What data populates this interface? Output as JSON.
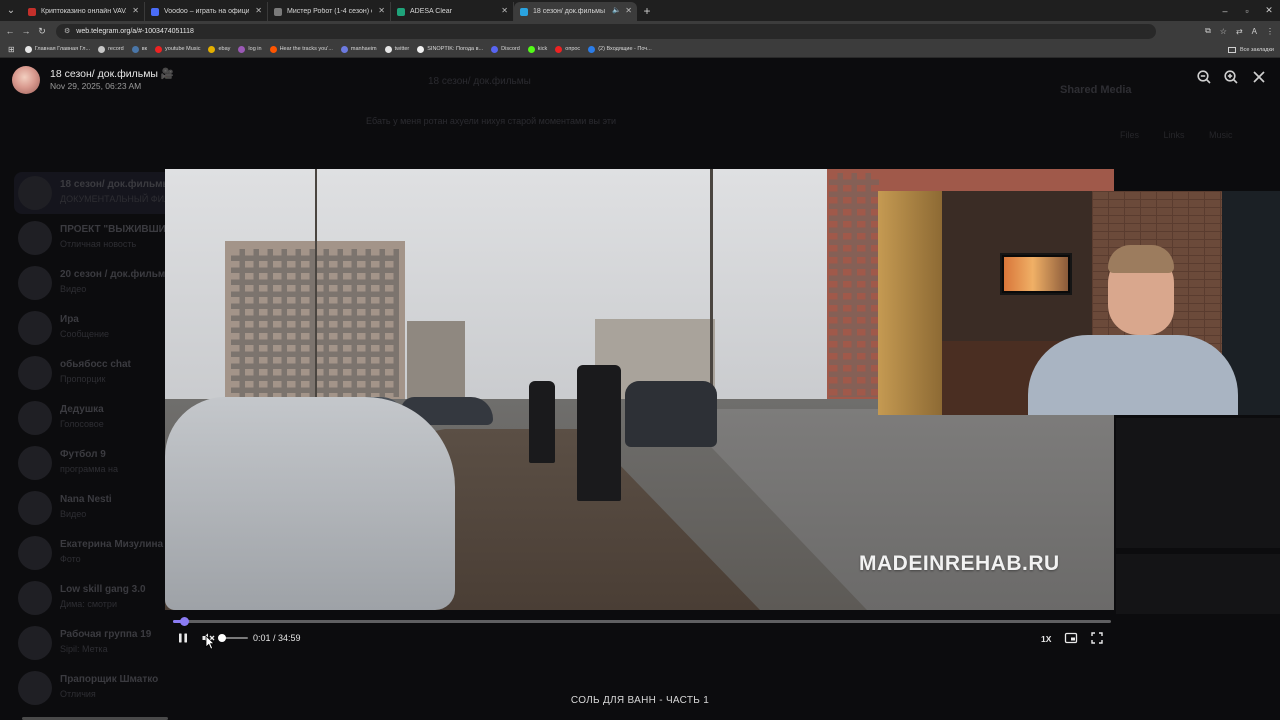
{
  "browser": {
    "tabs": [
      {
        "label": "Криптоказино онлайн VAVADA",
        "favicon_color": "#c4302b",
        "active": false
      },
      {
        "label": "Voodoo – играть на официальн",
        "favicon_color": "#4a6cf7",
        "active": false
      },
      {
        "label": "Мистер Робот (1-4 сезон) см",
        "favicon_color": "#7a7a7a",
        "active": false
      },
      {
        "label": "ADESA Clear",
        "favicon_color": "#1fa37a",
        "active": false
      },
      {
        "label": "18 сезон/ док.фильмы",
        "favicon_color": "#2aa3e0",
        "active": true
      }
    ],
    "address": "web.telegram.org/a/#-1003474051118",
    "bookmarks": [
      {
        "label": "Главная Главная Гл...",
        "color": "#e6e6e6"
      },
      {
        "label": "record",
        "color": "#c7c7c7"
      },
      {
        "label": "вк",
        "color": "#4a76a8"
      },
      {
        "label": "youtube Music",
        "color": "#e22"
      },
      {
        "label": "ebay",
        "color": "#e5b000"
      },
      {
        "label": "log in",
        "color": "#9b59b6"
      },
      {
        "label": "Hear the tracks you'...",
        "color": "#ff5500"
      },
      {
        "label": "manhaeim",
        "color": "#6c7ae0"
      },
      {
        "label": "twitter",
        "color": "#e6e6e6"
      },
      {
        "label": "SINOPTIK: Погода в...",
        "color": "#f0f0f0"
      },
      {
        "label": "Discord",
        "color": "#5865f2"
      },
      {
        "label": "kick",
        "color": "#53fc18"
      },
      {
        "label": "опрос",
        "color": "#e22"
      },
      {
        "label": "(2) Входящие - Поч...",
        "color": "#2b7de9"
      }
    ],
    "bookmarks_all": "Все закладки"
  },
  "viewer": {
    "title": "18 сезон/ док.фильмы 🎥",
    "date": "Nov 29, 2025, 06:23 AM",
    "zoom_out_icon": "zoom-out-icon",
    "zoom_in_icon": "zoom-in-icon",
    "close_icon": "close-icon"
  },
  "video": {
    "watermark": "MADEINREHAB.RU",
    "current_time": "0:01",
    "duration": "34:59",
    "time_display": "0:01 / 34:59",
    "progress_fraction": 0.0005,
    "buffered_fraction": 0.015,
    "volume_fraction": 0.0,
    "muted": true,
    "speed": "1X",
    "caption": "СОЛЬ ДЛЯ ВАНН - ЧАСТЬ 1",
    "accent_color": "#8b7cf3"
  },
  "background_telegram": {
    "chats": [
      {
        "name": "18 сезон/ док.фильмы",
        "preview": "ДОКУМЕНТАЛЬНЫЙ ФИЛЬМ"
      },
      {
        "name": "ПРОЕКТ \"ВЫЖИВШИЕ\"",
        "preview": "Отличная новость"
      },
      {
        "name": "20 сезон / док.фильм",
        "preview": "Видео"
      },
      {
        "name": "Ира",
        "preview": "Сообщение"
      },
      {
        "name": "обьябосс chat",
        "preview": "Пропорцик"
      },
      {
        "name": "Дедушка",
        "preview": "Голосовое"
      },
      {
        "name": "Футбол 9",
        "preview": "программа на"
      },
      {
        "name": "Nana Nesti",
        "preview": "Видео"
      },
      {
        "name": "Екатерина Мизулина",
        "preview": "Фото"
      },
      {
        "name": "Low skill gang 3.0",
        "preview": "Дима: смотри"
      },
      {
        "name": "Рабочая группа 19",
        "preview": "Sipil: Метка"
      },
      {
        "name": "Прапорщик Шматко",
        "preview": "Отличия"
      }
    ],
    "shared_media": "Shared Media",
    "media_tabs": "Files Links Music",
    "center_title": "18 сезон/ док.фильмы",
    "center_message": "Ебать у меня ротан ахуели нихуя старой моментами вы эти"
  }
}
